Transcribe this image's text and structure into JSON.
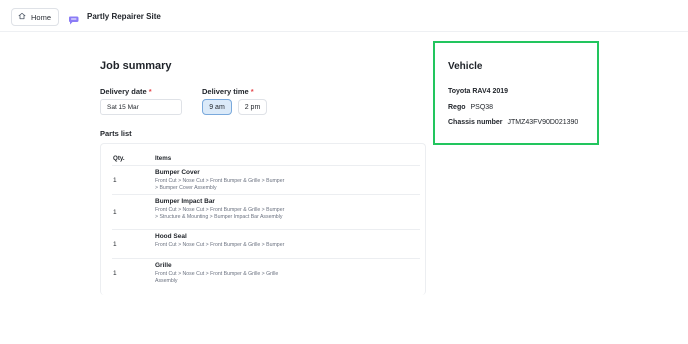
{
  "header": {
    "home_label": "Home",
    "site_name": "Partly Repairer Site"
  },
  "job": {
    "title": "Job summary",
    "delivery_date_label": "Delivery date",
    "delivery_date_value": "Sat 15 Mar",
    "delivery_time_label": "Delivery time",
    "required_mark": "*",
    "time_options": [
      "9 am",
      "2 pm"
    ],
    "selected_time": "9 am"
  },
  "parts": {
    "title": "Parts list",
    "col_qty": "Qty.",
    "col_items": "Items",
    "rows": [
      {
        "qty": "1",
        "name": "Bumper Cover",
        "path": "Front Cut > Nose Cut > Front Bumper & Grille > Bumper > Bumper Cover Assembly"
      },
      {
        "qty": "1",
        "name": "Bumper Impact Bar",
        "path": "Front Cut > Nose Cut > Front Bumper & Grille > Bumper > Structure & Mounting > Bumper Impact Bar Assembly"
      },
      {
        "qty": "1",
        "name": "Hood Seal",
        "path": "Front Cut > Nose Cut > Front Bumper & Grille > Bumper"
      },
      {
        "qty": "1",
        "name": "Grille",
        "path": "Front Cut > Nose Cut > Front Bumper & Grille > Grille Assembly"
      }
    ]
  },
  "vehicle": {
    "title": "Vehicle",
    "model": "Toyota RAV4 2019",
    "rego_label": "Rego",
    "rego_value": "PSQ38",
    "chassis_label": "Chassis number",
    "chassis_value": "JTMZ43FV90D021390"
  },
  "colors": {
    "accent_highlight": "#22c55e",
    "selected_bg": "#dbeaf9",
    "selected_border": "#7aa9dc",
    "required": "#e5484d"
  },
  "icons": {
    "home": "home-icon",
    "logo": "partly-logo-icon"
  }
}
